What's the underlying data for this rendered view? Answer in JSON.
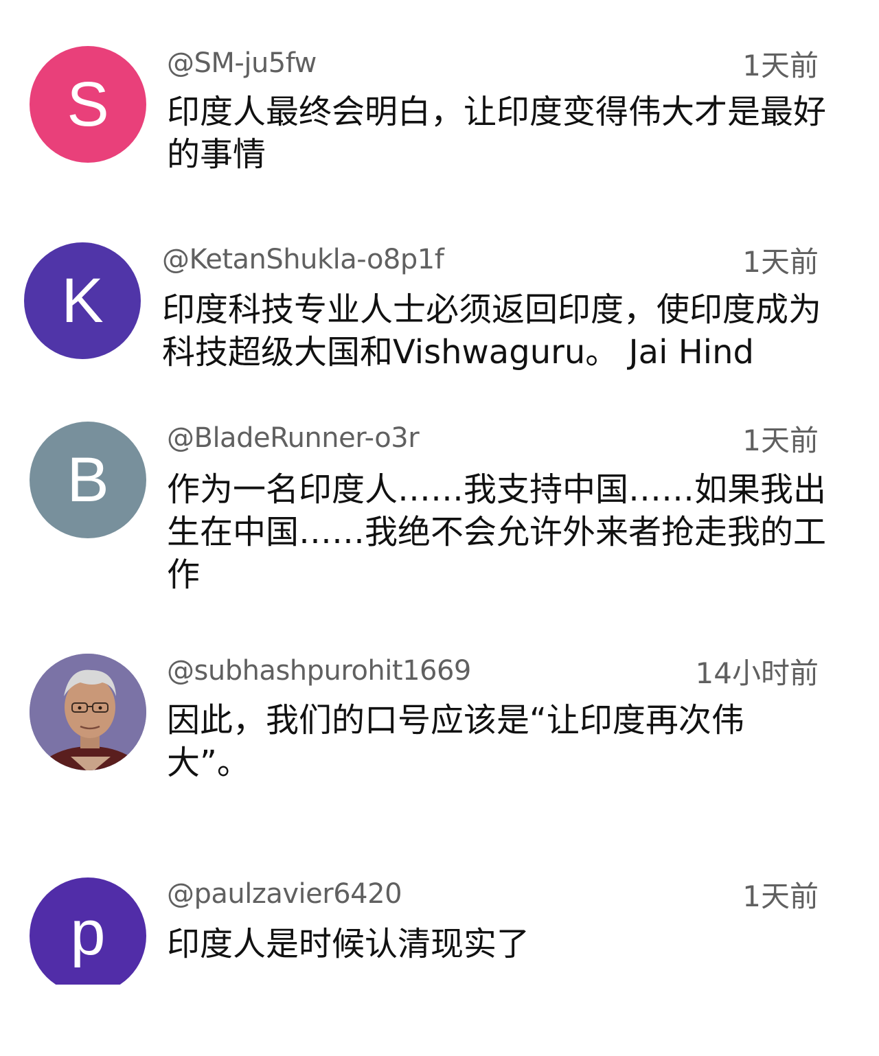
{
  "comments": [
    {
      "username": "@SM-ju5fw",
      "time": "1天前",
      "text": "印度人最终会明白，让印度变得伟大才是最好的事情",
      "avatar_letter": "S",
      "avatar_color": "#e9407a"
    },
    {
      "username": "@KetanShukla-o8p1f",
      "time": "1天前",
      "text": "印度科技专业人士必须返回印度，使印度成为科技超级大国和Vishwaguru。 Jai Hind",
      "avatar_letter": "K",
      "avatar_color": "#5035a8"
    },
    {
      "username": "@BladeRunner-o3r",
      "time": "1天前",
      "text": "作为一名印度人……我支持中国……如果我出生在中国……我绝不会允许外来者抢走我的工作",
      "avatar_letter": "B",
      "avatar_color": "#78909c"
    },
    {
      "username": "@subhashpurohit1669",
      "time": "14小时前",
      "text": "因此，我们的口号应该是“让印度再次伟大”。",
      "avatar_type": "photo"
    },
    {
      "username": "@paulzavier6420",
      "time": "1天前",
      "text": "印度人是时候认清现实了",
      "avatar_letter": "p",
      "avatar_color": "#512da8"
    }
  ]
}
